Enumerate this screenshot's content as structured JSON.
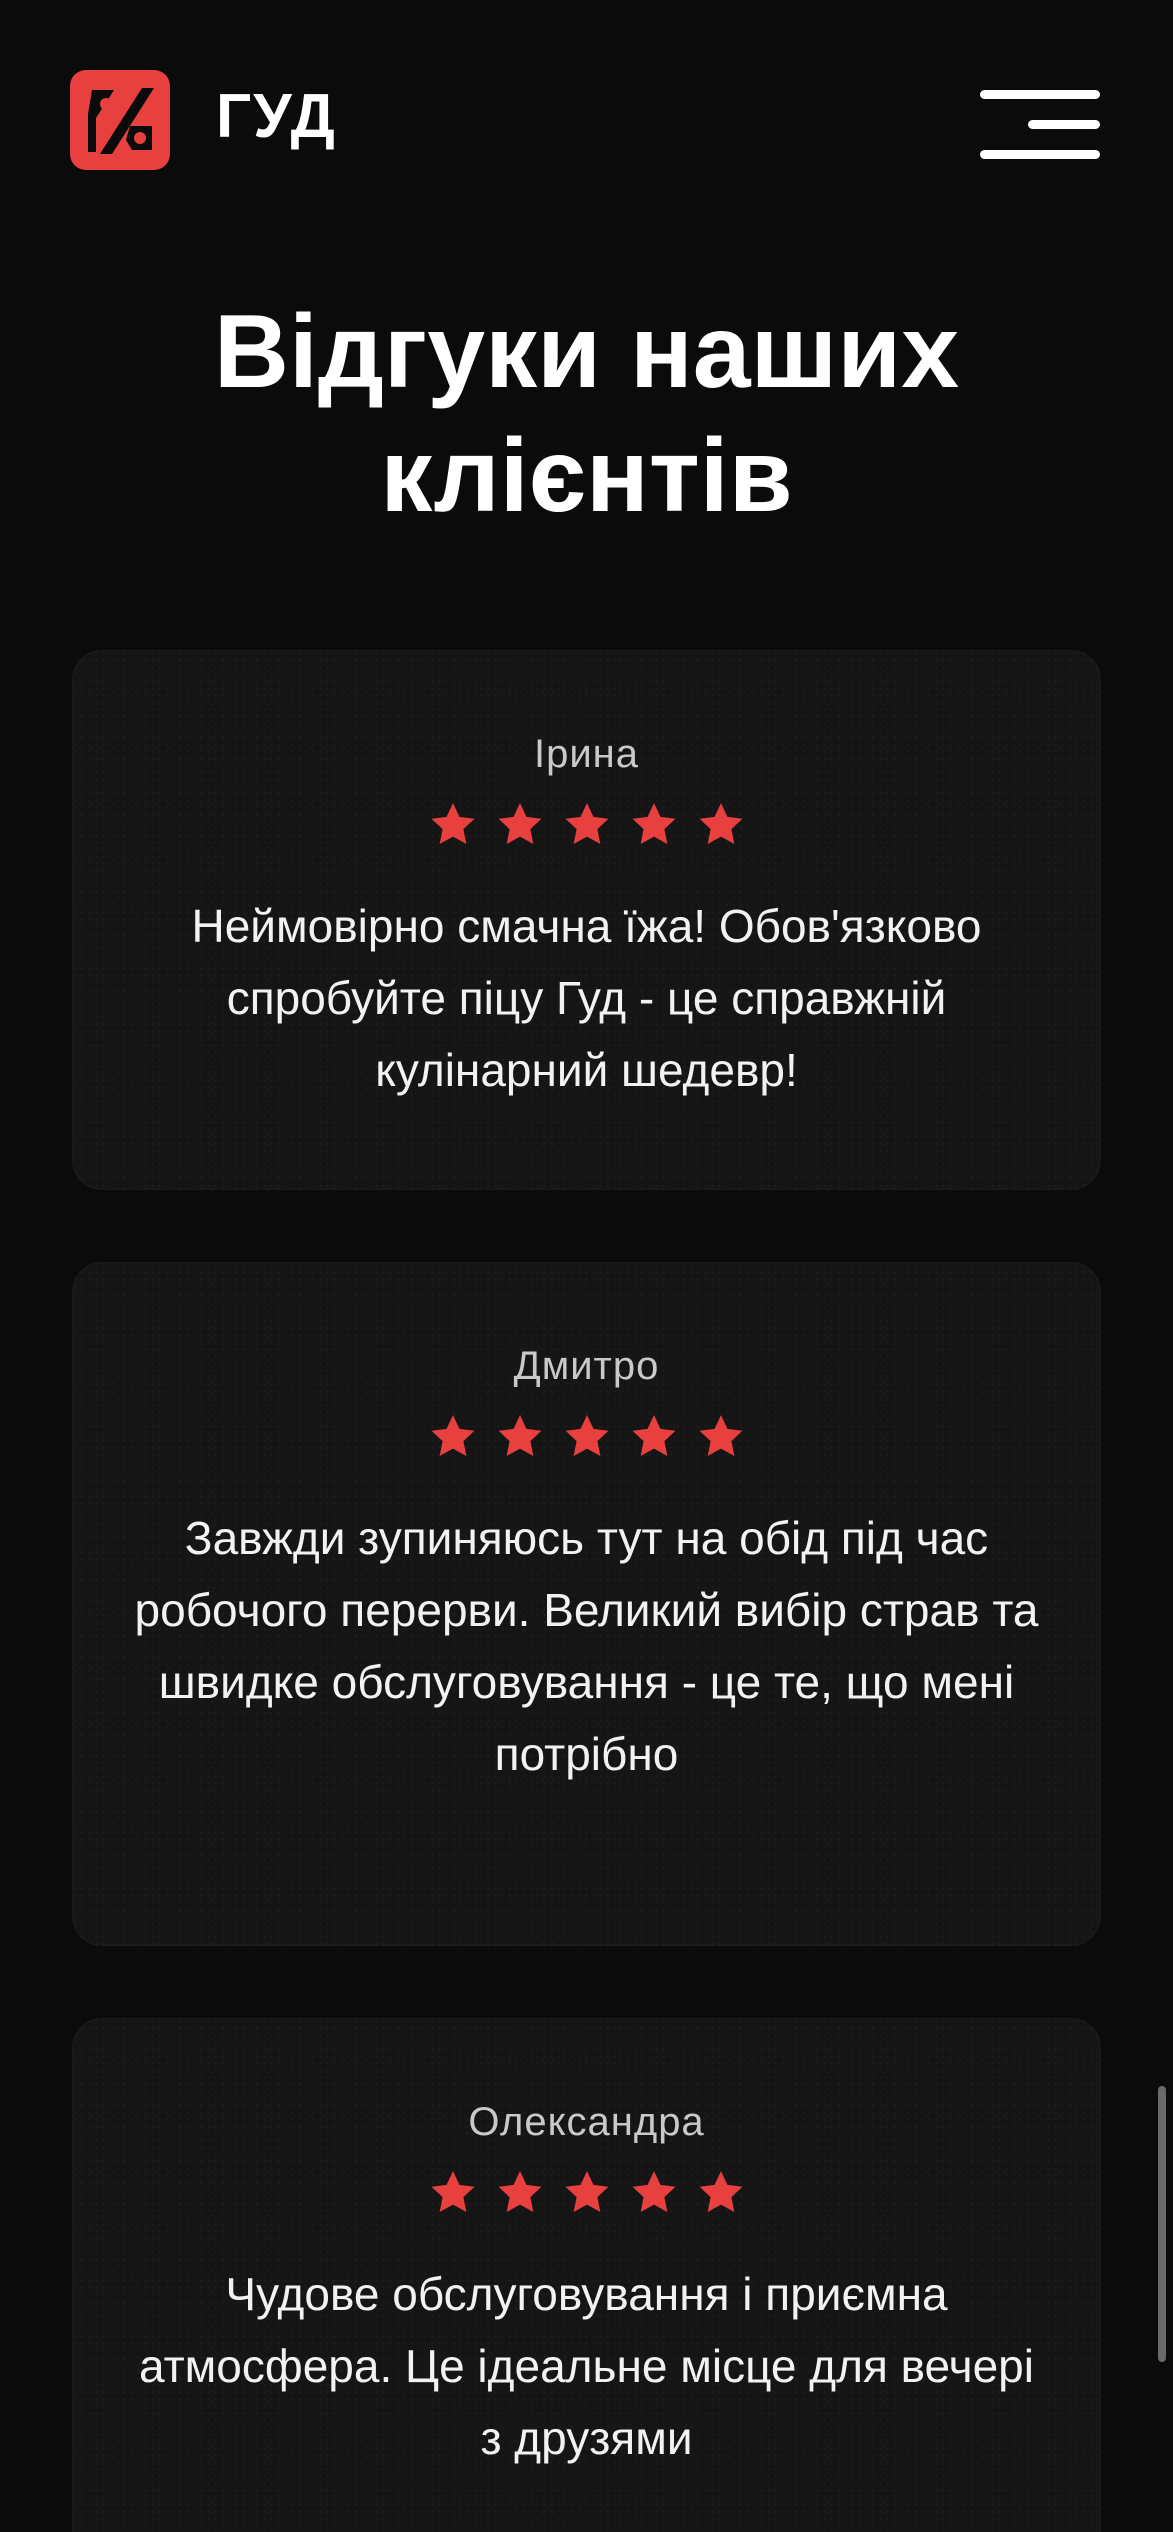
{
  "header": {
    "logo_text": "ГУД",
    "logo_icon": "pizza-slice-percent-icon",
    "menu_icon": "hamburger-menu-icon"
  },
  "section": {
    "title": "Відгуки наших клієнтів"
  },
  "reviews": [
    {
      "name": "Ірина",
      "rating": 5,
      "text": "Неймовірно смачна їжа! Обов'язково спробуйте піцу Гуд - це справжній кулінарний шедевр!"
    },
    {
      "name": "Дмитро",
      "rating": 5,
      "text": "Завжди зупиняюсь тут на обід під час робочого перерви. Великий вибір страв та швидке обслуговування - це те, що мені потрібно"
    },
    {
      "name": "Олександра",
      "rating": 5,
      "text": "Чудове обслуговування і приємна атмосфера. Це ідеальне місце для вечері з друзями"
    }
  ],
  "colors": {
    "accent": "#e8403f",
    "background": "#0b0b0c",
    "card": "#151516",
    "text": "#ffffff"
  }
}
